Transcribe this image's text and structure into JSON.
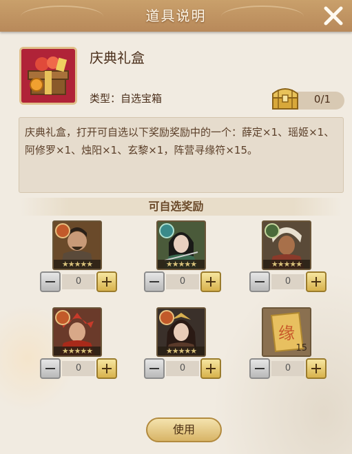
{
  "window": {
    "title": "道具说明"
  },
  "item": {
    "name": "庆典礼盒",
    "type_label": "类型：自选宝箱",
    "count": "0/1",
    "description": "庆典礼盒，打开可自选以下奖励奖励中的一个：薛定×1、瑶姬×1、阿修罗×1、烛阳×1、玄黎×1，阵营寻缘符×15。"
  },
  "section": {
    "title": "可自选奖励"
  },
  "rewards": [
    {
      "stars": "★★★★★",
      "quantity": "0"
    },
    {
      "stars": "★★★★★",
      "quantity": "0"
    },
    {
      "stars": "★★★★★",
      "quantity": "0"
    },
    {
      "stars": "★★★★★",
      "quantity": "0"
    },
    {
      "stars": "★★★★★",
      "quantity": "0"
    },
    {
      "glyph": "缘",
      "amount": "15",
      "quantity": "0"
    }
  ],
  "footer": {
    "use_label": "使用"
  },
  "icons": {
    "close": "close-icon",
    "chest": "treasure-chest-icon",
    "gift": "gift-box-icon"
  },
  "colors": {
    "panel_bg": "#f1ebe1",
    "title_bar": "#b8895a",
    "accent_gold": "#d8b24c",
    "text_brown": "#4a2e1a"
  }
}
